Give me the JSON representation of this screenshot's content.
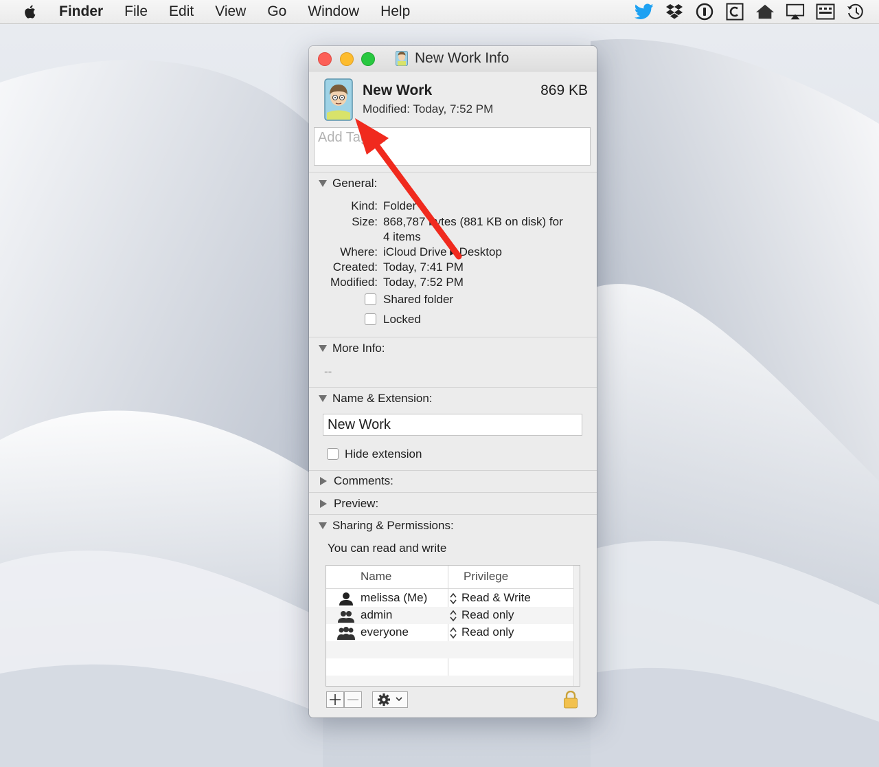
{
  "menubar": {
    "app_name": "Finder",
    "items": [
      "File",
      "Edit",
      "View",
      "Go",
      "Window",
      "Help"
    ],
    "tray_icons": [
      "twitter-icon",
      "dropbox-icon",
      "1password-icon",
      "copyclip-icon",
      "home-icon",
      "airplay-icon",
      "keyboard-icon",
      "time-machine-icon"
    ]
  },
  "window": {
    "title": "New Work Info",
    "header": {
      "name": "New Work",
      "size": "869 KB",
      "modified": "Modified:  Today, 7:52 PM"
    },
    "tags_placeholder": "Add Tags...",
    "general": {
      "heading": "General:",
      "kind_label": "Kind:",
      "kind_value": "Folder",
      "size_label": "Size:",
      "size_value_line1": "868,787 bytes (881 KB on disk) for",
      "size_value_line2": "4 items",
      "where_label": "Where:",
      "where_value": "iCloud Drive ▸ Desktop",
      "created_label": "Created:",
      "created_value": "Today, 7:41 PM",
      "modified_label": "Modified:",
      "modified_value": "Today, 7:52 PM",
      "shared_folder": "Shared folder",
      "locked": "Locked"
    },
    "more_info": {
      "heading": "More Info:",
      "value": "--"
    },
    "name_extension": {
      "heading": "Name & Extension:",
      "name_value": "New Work",
      "hide_extension": "Hide extension"
    },
    "comments": {
      "heading": "Comments:"
    },
    "preview": {
      "heading": "Preview:"
    },
    "sharing": {
      "heading": "Sharing & Permissions:",
      "summary": "You can read and write",
      "columns": [
        "Name",
        "Privilege"
      ],
      "rows": [
        {
          "name": "melissa (Me)",
          "privilege": "Read & Write",
          "icon": "single-user-icon"
        },
        {
          "name": "admin",
          "privilege": "Read only",
          "icon": "group-icon"
        },
        {
          "name": "everyone",
          "privilege": "Read only",
          "icon": "everyone-icon"
        }
      ]
    }
  },
  "colors": {
    "close": "#fc5f57",
    "minimize": "#fdbc2e",
    "maximize": "#28c840",
    "annotation_arrow": "#f02a1e",
    "twitter": "#1da1f2"
  }
}
